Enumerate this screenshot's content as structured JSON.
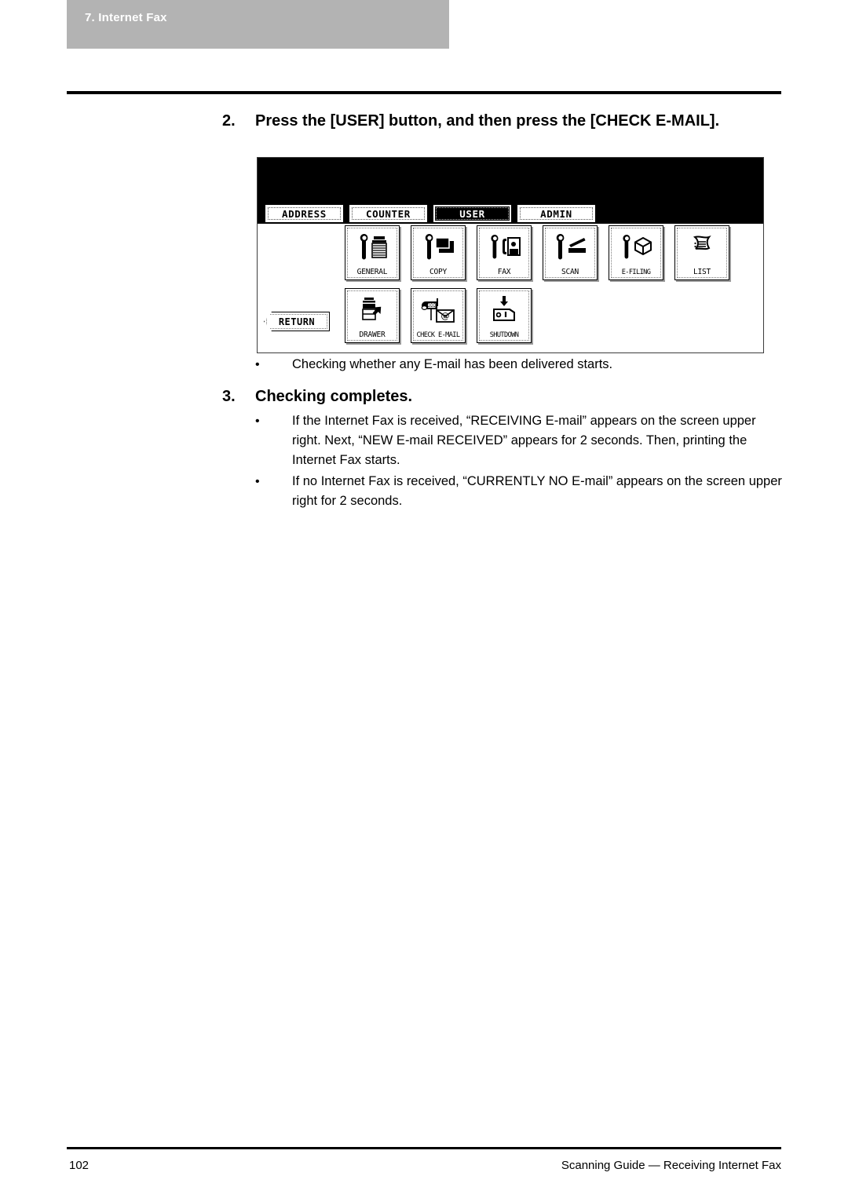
{
  "chapter": {
    "label": "7. Internet Fax"
  },
  "steps": [
    {
      "number": "2.",
      "title": "Press the [USER] button, and then press the [CHECK E-MAIL].",
      "bullets": [
        "Checking whether any E-mail has been delivered starts."
      ]
    },
    {
      "number": "3.",
      "title": "Checking completes.",
      "bullets": [
        "If the Internet Fax is received, “RECEIVING E-mail” appears on the screen upper right. Next, “NEW E-mail RECEIVED” appears for 2 seconds. Then, printing the Internet Fax starts.",
        "If no Internet Fax is received, “CURRENTLY NO E-mail” appears on the screen upper right for 2 seconds."
      ]
    }
  ],
  "bullet_marker": "•",
  "lcd_panel": {
    "message_area": "",
    "tabs": [
      {
        "label": "ADDRESS",
        "selected": false
      },
      {
        "label": "COUNTER",
        "selected": false
      },
      {
        "label": "USER",
        "selected": true
      },
      {
        "label": "ADMIN",
        "selected": false
      }
    ],
    "return_button": "RETURN",
    "buttons_row1": [
      {
        "label": "GENERAL",
        "icon": "wrench-copier-icon"
      },
      {
        "label": "COPY",
        "icon": "wrench-paper-icon"
      },
      {
        "label": "FAX",
        "icon": "wrench-fax-icon"
      },
      {
        "label": "SCAN",
        "icon": "wrench-scanner-icon"
      },
      {
        "label": "E-FILING",
        "icon": "wrench-box-icon"
      },
      {
        "label": "LIST",
        "icon": "document-list-icon"
      }
    ],
    "buttons_row2": [
      {
        "label": "DRAWER",
        "icon": "copier-arrow-icon"
      },
      {
        "label": "CHECK E-MAIL",
        "icon": "mailbox-at-envelope-icon"
      },
      {
        "label": "SHUTDOWN",
        "icon": "power-switch-down-arrow-icon"
      }
    ]
  },
  "footer": {
    "page_number": "102",
    "guide_title": "Scanning Guide — Receiving Internet Fax"
  },
  "colors": {
    "banner_gray": "#b3b3b3",
    "rule_black": "#000000",
    "panel_white": "#ffffff"
  }
}
